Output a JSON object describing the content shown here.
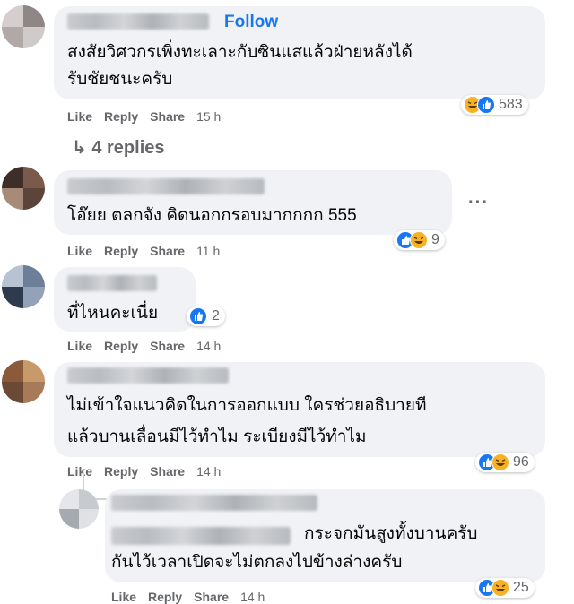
{
  "comments": [
    {
      "text_lines": [
        "สงสัยวิศวกรเพิ่งทะเลาะกับซินแสแล้วฝ่ายหลังได้",
        "รับชัยชนะครับ"
      ],
      "follow_label": "Follow",
      "like": "Like",
      "reply": "Reply",
      "share": "Share",
      "time": "15 h",
      "reaction_count": "583",
      "replies_label": "4 replies"
    },
    {
      "text_lines": [
        "โอ๊ยย ตลกจัง คิดนอกกรอบมากกกก 555"
      ],
      "like": "Like",
      "reply": "Reply",
      "share": "Share",
      "time": "11 h",
      "reaction_count": "9",
      "more_label": "···"
    },
    {
      "text_lines": [
        "ที่ไหนคะเนี่ย"
      ],
      "like": "Like",
      "reply": "Reply",
      "share": "Share",
      "time": "14 h",
      "reaction_count": "2"
    },
    {
      "text_lines": [
        "ไม่เข้าใจแนวคิดในการออกแบบ ใครช่วยอธิบายที",
        "แล้วบานเลื่อนมีไว้ทำไม ระเบียงมีไว้ทำไม"
      ],
      "like": "Like",
      "reply": "Reply",
      "share": "Share",
      "time": "14 h",
      "reaction_count": "96"
    },
    {
      "text_lines": [
        "กระจกมันสูงทั้งบานครับ",
        "กันไว้เวลาเปิดจะไม่ตกลงไปข้างล่างครับ"
      ],
      "like": "Like",
      "reply": "Reply",
      "share": "Share",
      "time": "14 h",
      "reaction_count": "25"
    }
  ],
  "colors": {
    "bubble": "#f0f2f5",
    "link": "#1877f2",
    "meta": "#65676b",
    "like": "#1877f2",
    "haha": "#f7b125"
  },
  "icons": [
    "like-reaction-icon",
    "haha-reaction-icon",
    "reply-arrow-icon",
    "more-options-icon"
  ]
}
